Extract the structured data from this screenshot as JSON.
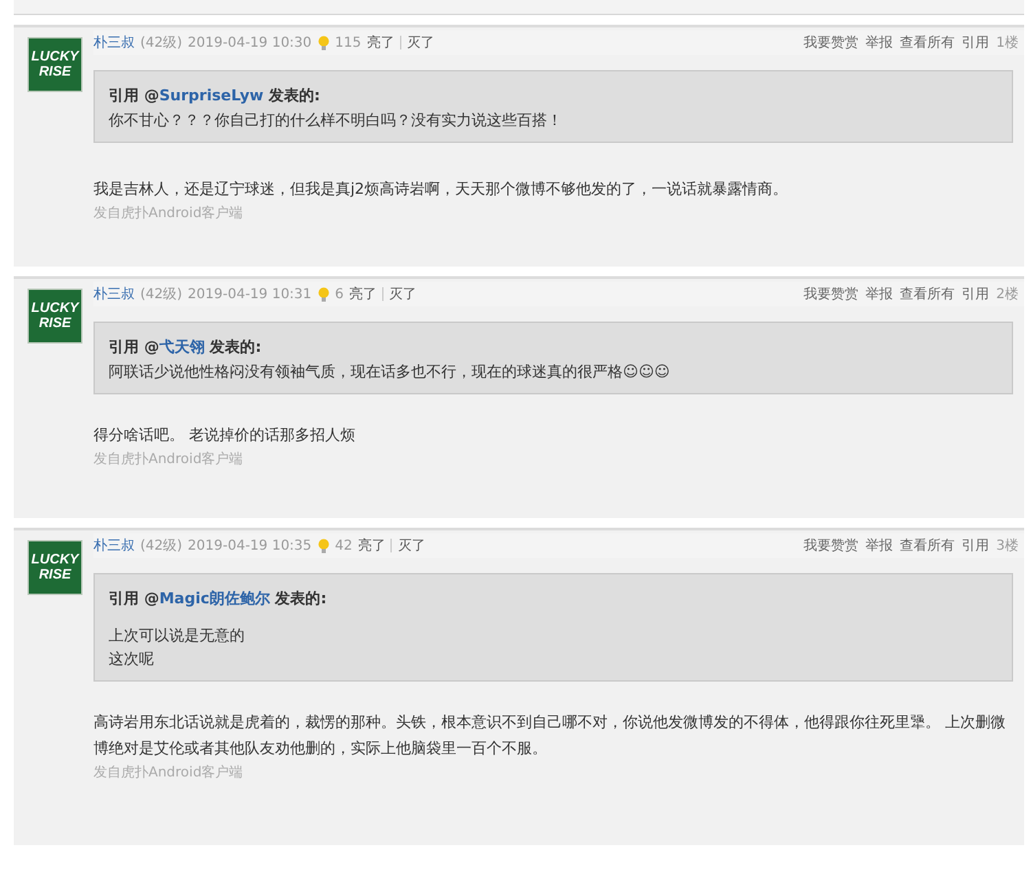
{
  "posts": [
    {
      "avatar": {
        "lines": [
          "LUCKY",
          "RISE"
        ]
      },
      "author": "朴三叔",
      "level": "(42级)",
      "time": "2019-04-19 10:30",
      "likes": "115",
      "light": "亮了",
      "dark": "灭了",
      "actions": [
        "我要赞赏",
        "举报",
        "查看所有",
        "引用"
      ],
      "floor": "1楼",
      "quote": {
        "prefix": "引用 @",
        "user": "SurpriseLyw",
        "suffix": "发表的:",
        "lines": [
          "你不甘心？？？你自己打的什么样不明白吗？没有实力说这些百搭！"
        ],
        "spaced": false
      },
      "body": "我是吉林人，还是辽宁球迷，但我是真j2烦高诗岩啊，天天那个微博不够他发的了，一说话就暴露情商。",
      "source": "发自虎扑Android客户端"
    },
    {
      "avatar": {
        "lines": [
          "LUCKY",
          "RISE"
        ]
      },
      "author": "朴三叔",
      "level": "(42级)",
      "time": "2019-04-19 10:31",
      "likes": "6",
      "light": "亮了",
      "dark": "灭了",
      "actions": [
        "我要赞赏",
        "举报",
        "查看所有",
        "引用"
      ],
      "floor": "2楼",
      "quote": {
        "prefix": "引用 @",
        "user": "弋天翎",
        "suffix": "发表的:",
        "lines": [
          "阿联话少说他性格闷没有领袖气质，现在话多也不行，现在的球迷真的很严格☺☺☺"
        ],
        "spaced": false
      },
      "body": "得分啥话吧。 老说掉价的话那多招人烦",
      "source": "发自虎扑Android客户端"
    },
    {
      "avatar": {
        "lines": [
          "LUCKY",
          "RISE"
        ]
      },
      "author": "朴三叔",
      "level": "(42级)",
      "time": "2019-04-19 10:35",
      "likes": "42",
      "light": "亮了",
      "dark": "灭了",
      "actions": [
        "我要赞赏",
        "举报",
        "查看所有",
        "引用"
      ],
      "floor": "3楼",
      "quote": {
        "prefix": "引用 @",
        "user": "Magic朗佐鲍尔",
        "suffix": "发表的:",
        "lines": [
          "上次可以说是无意的",
          "这次呢"
        ],
        "spaced": true
      },
      "body": "高诗岩用东北话说就是虎着的，裁愣的那种。头铁，根本意识不到自己哪不对，你说他发微博发的不得体，他得跟你往死里犟。 上次删微博绝对是艾伦或者其他队友劝他删的，实际上他脑袋里一百个不服。",
      "source": "发自虎扑Android客户端"
    }
  ]
}
